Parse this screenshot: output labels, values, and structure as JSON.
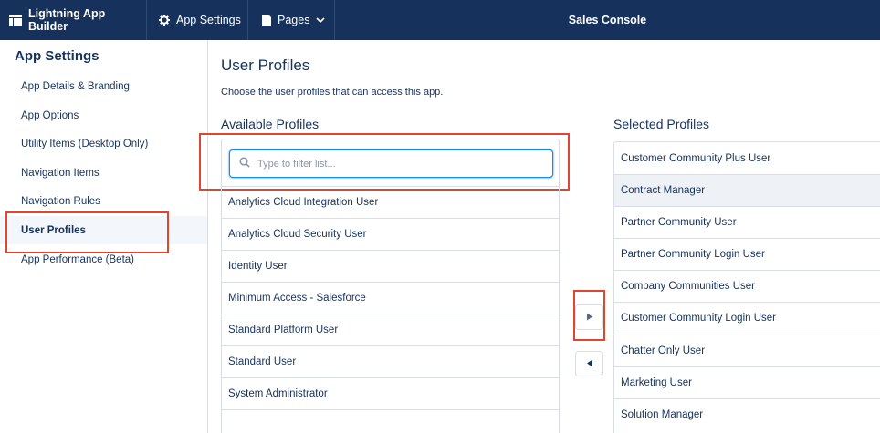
{
  "topbar": {
    "builder_label": "Lightning App Builder",
    "settings_label": "App Settings",
    "pages_label": "Pages",
    "app_title": "Sales Console"
  },
  "sidebar": {
    "heading": "App Settings",
    "items": [
      {
        "label": "App Details & Branding"
      },
      {
        "label": "App Options"
      },
      {
        "label": "Utility Items (Desktop Only)"
      },
      {
        "label": "Navigation Items"
      },
      {
        "label": "Navigation Rules"
      },
      {
        "label": "User Profiles"
      },
      {
        "label": "App Performance (Beta)"
      }
    ],
    "active_item": "User Profiles"
  },
  "main": {
    "title": "User Profiles",
    "description": "Choose the user profiles that can access this app.",
    "available_heading": "Available Profiles",
    "selected_heading": "Selected Profiles",
    "search_placeholder": "Type to filter list...",
    "available_profiles": [
      "Analytics Cloud Integration User",
      "Analytics Cloud Security User",
      "Identity User",
      "Minimum Access - Salesforce",
      "Standard Platform User",
      "Standard User",
      "System Administrator"
    ],
    "selected_profiles": [
      "Customer Community Plus User",
      "Contract Manager",
      "Partner Community User",
      "Partner Community Login User",
      "Company Communities User",
      "Customer Community Login User",
      "Chatter Only User",
      "Marketing User",
      "Solution Manager"
    ],
    "highlighted_selected": "Contract Manager"
  },
  "colors": {
    "topbar_bg": "#16325c",
    "text": "#16325c",
    "annotation_red": "#e0462f",
    "focus_blue": "#1589ee"
  }
}
